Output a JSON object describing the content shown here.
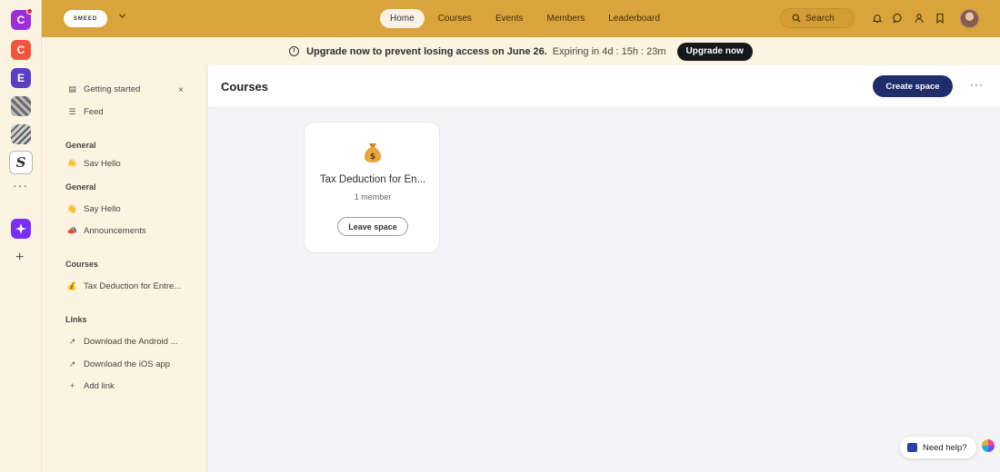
{
  "rail": {
    "communities": [
      {
        "initial": "C"
      },
      {
        "initial": "C"
      },
      {
        "initial": "E"
      },
      {
        "initial": ""
      },
      {
        "initial": ""
      },
      {
        "initial": "S"
      }
    ],
    "more_label": "···",
    "add_label": "+"
  },
  "header": {
    "logo_text": "SMEED",
    "nav": [
      "Home",
      "Courses",
      "Events",
      "Members",
      "Leaderboard"
    ],
    "active_nav": "Home",
    "search_label": "Search",
    "icons": [
      "bell-icon",
      "chat-icon",
      "people-icon",
      "bookmark-icon"
    ]
  },
  "banner": {
    "message": "Upgrade now to prevent losing access on June 26.",
    "expiring": "Expiring in 4d : 15h : 23m",
    "button": "Upgrade now"
  },
  "sidebar": {
    "getting_started": "Getting started",
    "feed": "Feed",
    "sections": [
      {
        "title": "General",
        "items": [
          "Say Hello"
        ]
      },
      {
        "title": "General",
        "items": [
          "Say Hello",
          "Announcements"
        ]
      },
      {
        "title": "Courses",
        "items": [
          "Tax Deduction for Entre..."
        ]
      },
      {
        "title": "Links",
        "items": [
          "Download the Android ...",
          "Download the iOS app",
          "Add link"
        ]
      }
    ]
  },
  "main": {
    "title": "Courses",
    "create_button": "Create space",
    "more_label": "···",
    "card": {
      "title": "Tax Deduction for En...",
      "members": "1 member",
      "button": "Leave space"
    }
  },
  "help": {
    "label": "Need help?"
  },
  "colors": {
    "header_bg": "#d9a43c",
    "banner_bg": "#fdf3e1",
    "primary_button": "#1f2d6b",
    "upgrade_button": "#16171b"
  }
}
